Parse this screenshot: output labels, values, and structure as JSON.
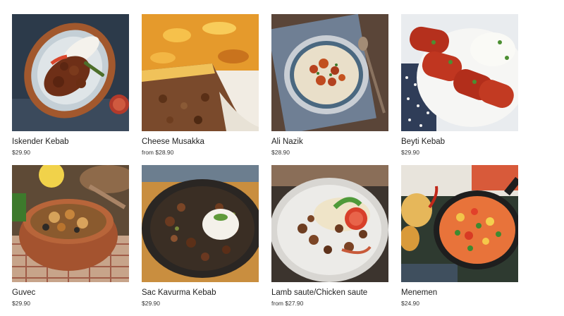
{
  "products": [
    {
      "name": "Iskender Kebab",
      "price": "$29.90",
      "image": "iskender-kebab"
    },
    {
      "name": "Cheese Musakka",
      "price": "from $28.90",
      "image": "cheese-musakka"
    },
    {
      "name": "Ali Nazik",
      "price": "$28.90",
      "image": "ali-nazik"
    },
    {
      "name": "Beyti Kebab",
      "price": "$29.90",
      "image": "beyti-kebab"
    },
    {
      "name": "Guvec",
      "price": "$29.90",
      "image": "guvec"
    },
    {
      "name": "Sac Kavurma Kebab",
      "price": "$29.90",
      "image": "sac-kavurma-kebab"
    },
    {
      "name": "Lamb saute/Chicken saute",
      "price": "from $27.90",
      "image": "lamb-saute"
    },
    {
      "name": "Menemen",
      "price": "$24.90",
      "image": "menemen"
    }
  ]
}
